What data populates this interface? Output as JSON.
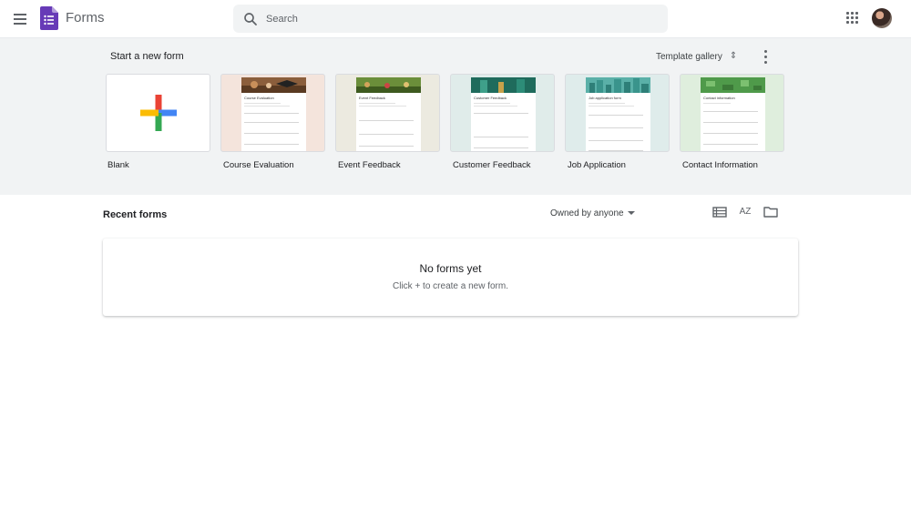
{
  "header": {
    "app_title": "Forms",
    "search_placeholder": "Search"
  },
  "new_form": {
    "title": "Start a new form",
    "gallery_label": "Template gallery",
    "templates": [
      {
        "label": "Blank"
      },
      {
        "label": "Course Evaluation",
        "thumb_title": "Course Evaluation"
      },
      {
        "label": "Event Feedback",
        "thumb_title": "Event Feedback"
      },
      {
        "label": "Customer Feedback",
        "thumb_title": "Customer Feedback"
      },
      {
        "label": "Job Application",
        "thumb_title": "Job application form"
      },
      {
        "label": "Contact Information",
        "thumb_title": "Contact information"
      }
    ]
  },
  "recent": {
    "title": "Recent forms",
    "owner_filter": "Owned by anyone",
    "sort_label": "AZ",
    "empty_title": "No forms yet",
    "empty_subtitle": "Click + to create a new form."
  },
  "colors": {
    "brand_purple": "#673ab7",
    "band_bg": "#f1f3f4",
    "plus_red": "#ea4335",
    "plus_blue": "#4285f4",
    "plus_yellow": "#fbbc04",
    "plus_green": "#34a853"
  }
}
